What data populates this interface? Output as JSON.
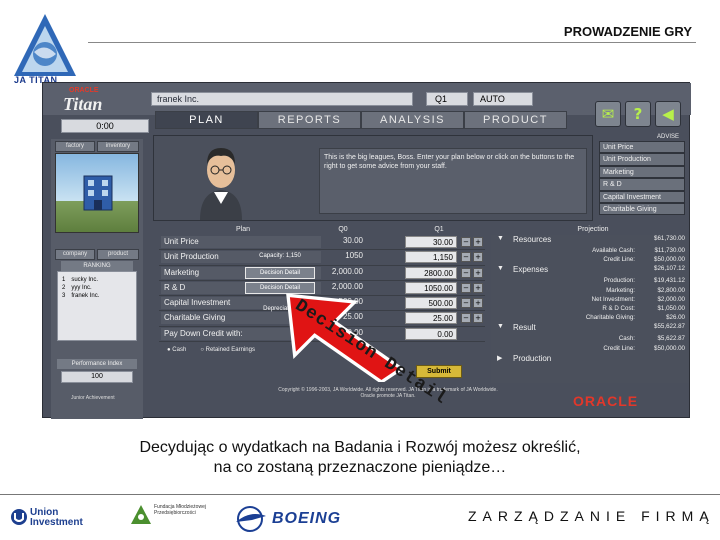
{
  "slide": {
    "title": "PROWADZENIE GRY",
    "top_logo_text": "JA TITAN",
    "caption_line1": "Decydując o wydatkach na Badania i Rozwój możesz określić,",
    "caption_line2": "na co zostaną przeznaczone pieniądze…",
    "footer_right": "ZARZĄDZANIE FIRMĄ",
    "callout": "Decision Detail",
    "sponsor_union": [
      "Union",
      "Investment"
    ],
    "sponsor_fund": "Fundacja Młodzieżowej Przedsiębiorczości",
    "sponsor_boeing": "BOEING"
  },
  "app": {
    "brand_small": "ORACLE",
    "brand_title": "Titan",
    "company": "franek Inc.",
    "quarter": "Q1",
    "mode": "AUTO",
    "timer": "0:00",
    "tabs": [
      "PLAN",
      "REPORTS",
      "ANALYSIS",
      "PRODUCT"
    ],
    "left_tabs": [
      "factory",
      "inventory",
      "company",
      "product"
    ],
    "ranking_title": "RANKING",
    "ranking": [
      {
        "pos": "1",
        "name": "sucky Inc."
      },
      {
        "pos": "2",
        "name": "yyy Inc."
      },
      {
        "pos": "3",
        "name": "franek Inc."
      }
    ],
    "perf_title": "Performance Index",
    "perf_value": "100",
    "ja_footer": "Junior Achievement",
    "advisor_text": "This is the big leagues, Boss. Enter your plan below or click on the buttons to the right to get some advice from your staff.",
    "advice_header": "ADVISE",
    "advice_items": [
      "Unit Price",
      "Unit Production",
      "Marketing",
      "R & D",
      "Capital Investment",
      "Charitable Giving"
    ],
    "table_headers": {
      "plan": "Plan",
      "q0": "Q0",
      "q1": "Q1",
      "projection": "Projection"
    },
    "rows": [
      {
        "label": "Unit Price",
        "button": "",
        "q0": "30.00",
        "q1": "30.00"
      },
      {
        "label": "Unit Production",
        "button": "Capacity: 1,150",
        "q0": "1050",
        "q1": "1,150"
      },
      {
        "label": "Marketing",
        "button": "Decision Detail",
        "q0": "2,000.00",
        "q1": "2800.00"
      },
      {
        "label": "R & D",
        "button": "Decision Detail",
        "q0": "2,000.00",
        "q1": "1050.00"
      },
      {
        "label": "Capital Investment",
        "button": "Depreciation",
        "q0": "500.00",
        "q1": "500.00"
      },
      {
        "label": "Charitable Giving",
        "button": "",
        "q0": "25.00",
        "q1": "25.00"
      },
      {
        "label": "Pay Down Credit with:",
        "button": "",
        "q0": "0.00",
        "q1": "0.00"
      }
    ],
    "pay_options": [
      "Cash",
      "Retained Earnings"
    ],
    "submit": "Submit",
    "projection": [
      {
        "type": "head",
        "k": "Resources",
        "v": "$61,730.00"
      },
      {
        "type": "line",
        "k": "Available Cash:",
        "v": "$11,730.00"
      },
      {
        "type": "line",
        "k": "Credit Line:",
        "v": "$50,000.00"
      },
      {
        "type": "head",
        "k": "Expenses",
        "v": "$26,107.12"
      },
      {
        "type": "line",
        "k": "Production:",
        "v": "$19,431.12"
      },
      {
        "type": "line",
        "k": "Marketing:",
        "v": "$2,800.00"
      },
      {
        "type": "line",
        "k": "Net Investment:",
        "v": "$2,000.00"
      },
      {
        "type": "line",
        "k": "R & D Cost:",
        "v": "$1,050.00"
      },
      {
        "type": "line",
        "k": "Charitable Giving:",
        "v": "$26.00"
      },
      {
        "type": "head",
        "k": "Result",
        "v": "$55,622.87"
      },
      {
        "type": "line",
        "k": "Cash:",
        "v": "$5,622.87"
      },
      {
        "type": "line",
        "k": "Credit Line:",
        "v": "$50,000.00"
      },
      {
        "type": "head",
        "k": "Production",
        "v": ""
      }
    ],
    "copyright": "Copyright © 1996-2003, JA Worldwide. All rights reserved. JA Titan is a trademark of JA Worldwide. Oracle promote JA Titan.",
    "oracle_bottom": "ORACLE"
  }
}
